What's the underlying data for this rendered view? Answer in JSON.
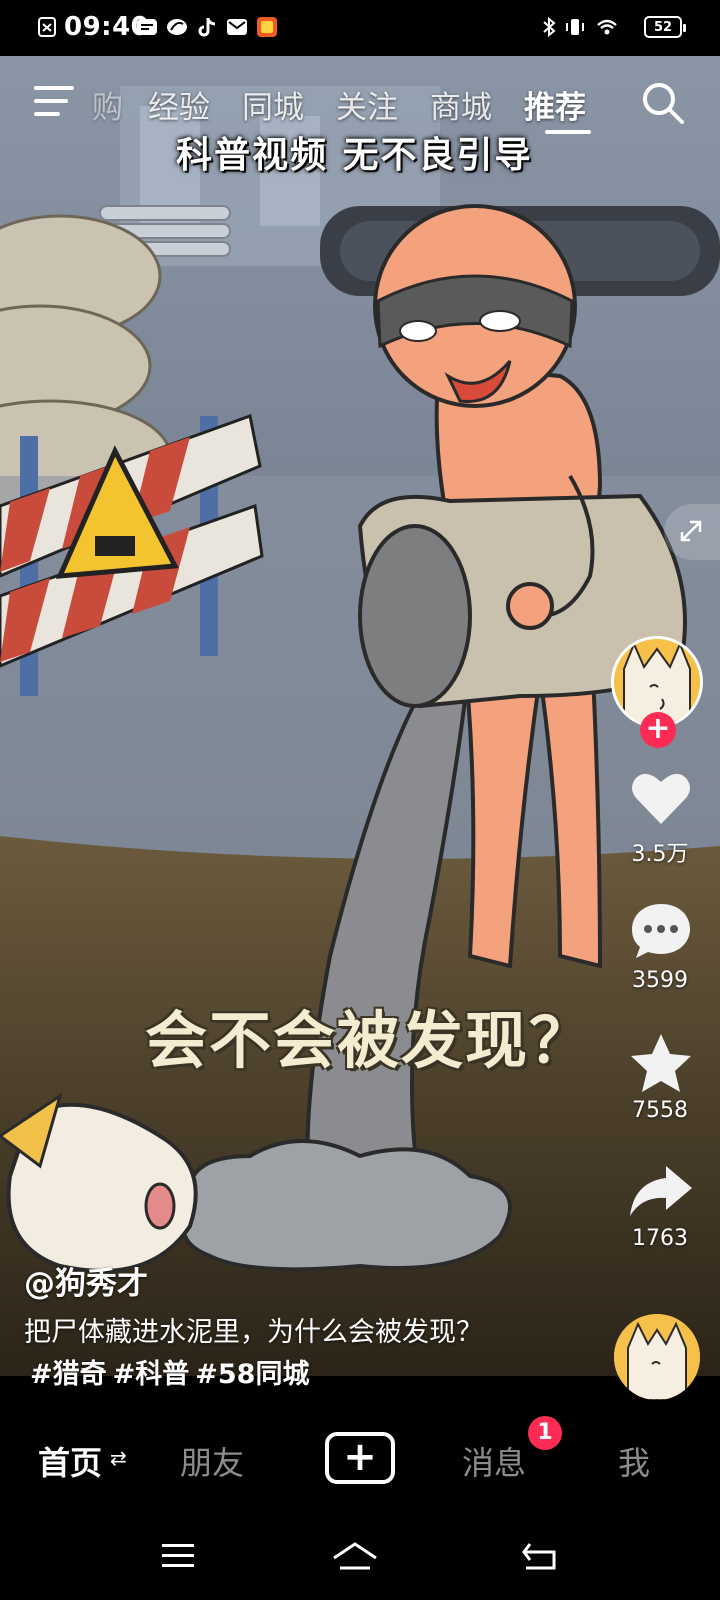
{
  "status_bar": {
    "time": "09:40",
    "battery": "52",
    "icons": [
      "notification-icon",
      "message-icon",
      "app-icon",
      "tiktok-icon",
      "mail-icon",
      "app-badge-icon",
      "bluetooth-icon",
      "vibrate-icon",
      "wifi-icon"
    ]
  },
  "top_nav": {
    "tabs": [
      {
        "label": "购"
      },
      {
        "label": "经验"
      },
      {
        "label": "同城"
      },
      {
        "label": "关注"
      },
      {
        "label": "商城"
      },
      {
        "label": "推荐"
      }
    ],
    "active_tab": "推荐"
  },
  "video": {
    "banner_text": "科普视频 无不良引导",
    "center_caption": "会不会被发现？"
  },
  "actions": {
    "likes": "3.5万",
    "comments": "3599",
    "favorites": "7558",
    "shares": "1763"
  },
  "post": {
    "author": "@狗秀才",
    "description": "把尸体藏进水泥里，为什么会被发现？",
    "hashtags": [
      "#猎奇",
      "#科普",
      "#58同城"
    ]
  },
  "bottom_nav": {
    "items": [
      {
        "label": "首页"
      },
      {
        "label": "朋友"
      },
      {
        "label": "消息"
      },
      {
        "label": "我"
      }
    ],
    "refresh_glyph": "⇄",
    "plus_glyph": "+",
    "message_badge": "1"
  },
  "colors": {
    "accent": "#fe2c55",
    "background": "#000000"
  }
}
